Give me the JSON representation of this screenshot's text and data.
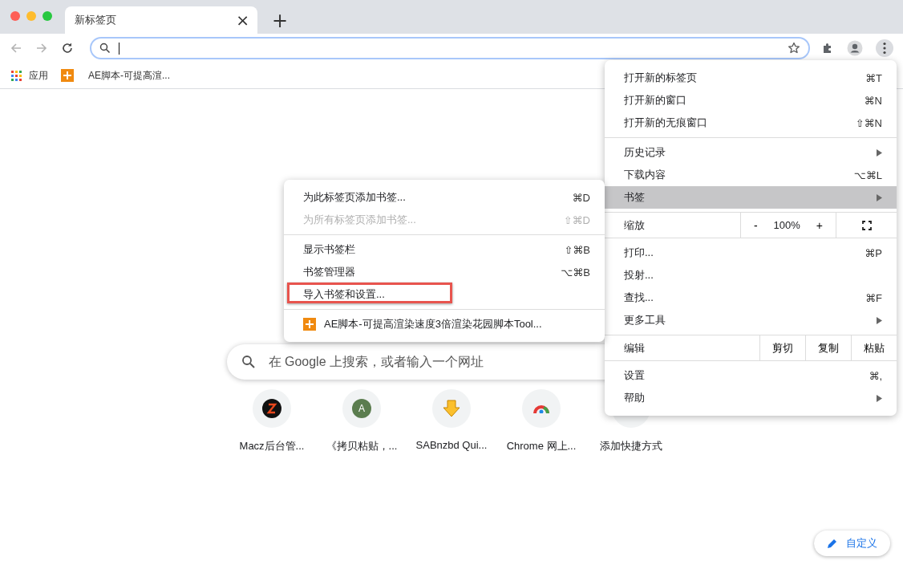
{
  "window": {
    "traffic_lights": [
      {
        "color": "#fe5f57"
      },
      {
        "color": "#febc2e"
      },
      {
        "color": "#28c840"
      }
    ]
  },
  "tabs": [
    {
      "title": "新标签页",
      "selected": true,
      "close": "×"
    }
  ],
  "new_tab": "+",
  "bookmarks_bar": [
    {
      "kind": "apps",
      "label": "应用"
    },
    {
      "kind": "page",
      "label": "AE脚本-可提高渲..."
    }
  ],
  "new_tab_page": {
    "search": {
      "placeholder": "在 Google 上搜索，或者输入一个网址"
    },
    "shortcuts": [
      {
        "kind": "z",
        "label": "Macz后台管..."
      },
      {
        "kind": "letter",
        "letter": "A",
        "label": "《拷贝粘贴，..."
      },
      {
        "kind": "download",
        "label": "SABnzbd Qui..."
      },
      {
        "kind": "store",
        "label": "Chrome 网上..."
      },
      {
        "kind": "add",
        "label": "添加快捷方式"
      }
    ],
    "customize": "自定义"
  },
  "main_menu": {
    "sections": [
      [
        {
          "kind": "item",
          "label": "打开新的标签页",
          "shortcut": "⌘T",
          "submenu": false,
          "selected": false
        },
        {
          "kind": "item",
          "label": "打开新的窗口",
          "shortcut": "⌘N",
          "submenu": false,
          "selected": false
        },
        {
          "kind": "item",
          "label": "打开新的无痕窗口",
          "shortcut": "⇧⌘N",
          "submenu": false,
          "selected": false
        }
      ],
      [
        {
          "kind": "item",
          "label": "历史记录",
          "submenu": true,
          "selected": false
        },
        {
          "kind": "item",
          "label": "下载内容",
          "shortcut": "⌥⌘L",
          "submenu": false,
          "selected": false
        },
        {
          "kind": "item",
          "label": "书签",
          "submenu": true,
          "selected": true
        }
      ],
      [
        {
          "kind": "zoom",
          "label": "缩放",
          "minus": "-",
          "value": "100%",
          "plus": "+"
        }
      ],
      [
        {
          "kind": "item",
          "label": "打印...",
          "shortcut": "⌘P",
          "submenu": false,
          "selected": false
        },
        {
          "kind": "item",
          "label": "投射...",
          "submenu": false,
          "selected": false
        },
        {
          "kind": "item",
          "label": "查找...",
          "shortcut": "⌘F",
          "submenu": false,
          "selected": false
        },
        {
          "kind": "item",
          "label": "更多工具",
          "submenu": true,
          "selected": false
        }
      ],
      [
        {
          "kind": "edit",
          "label": "编辑",
          "buttons": [
            "剪切",
            "复制",
            "粘贴"
          ]
        }
      ],
      [
        {
          "kind": "item",
          "label": "设置",
          "shortcut": "⌘,",
          "submenu": false,
          "selected": false
        },
        {
          "kind": "item",
          "label": "帮助",
          "submenu": true,
          "selected": false
        }
      ]
    ]
  },
  "bookmark_submenu": {
    "sections": [
      [
        {
          "kind": "item",
          "label": "为此标签页添加书签...",
          "shortcut": "⌘D",
          "disabled": false,
          "highlighted": false
        },
        {
          "kind": "item",
          "label": "为所有标签页添加书签...",
          "shortcut": "⇧⌘D",
          "disabled": true,
          "highlighted": false
        }
      ],
      [
        {
          "kind": "item",
          "label": "显示书签栏",
          "shortcut": "⇧⌘B",
          "disabled": false,
          "highlighted": false
        },
        {
          "kind": "item",
          "label": "书签管理器",
          "shortcut": "⌥⌘B",
          "disabled": false,
          "highlighted": false
        },
        {
          "kind": "item",
          "label": "导入书签和设置...",
          "disabled": false,
          "highlighted": true
        }
      ],
      [
        {
          "kind": "bookmark",
          "label": "AE脚本-可提高渲染速度3倍渲染花园脚本Tool...",
          "disabled": false,
          "highlighted": false
        }
      ]
    ]
  }
}
